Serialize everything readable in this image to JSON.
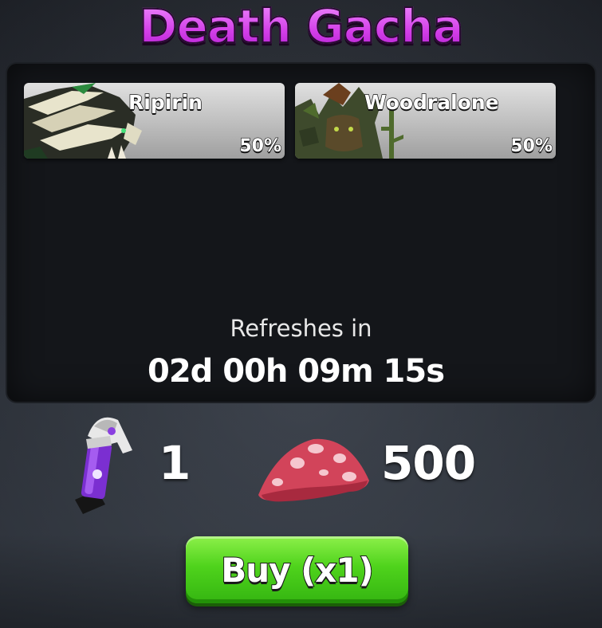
{
  "title": "Death Gacha",
  "pool": [
    {
      "name": "Ripirin",
      "chance": "50%",
      "icon": "skeletal-dragon-pet-icon"
    },
    {
      "name": "Woodralone",
      "chance": "50%",
      "icon": "tree-golem-pet-icon"
    }
  ],
  "refresh": {
    "label": "Refreshes in",
    "time": "02d 00h 09m 15s"
  },
  "cost": {
    "item_icon": "purple-skull-capsule-icon",
    "item_count": "1",
    "currency_icon": "red-mushroom-icon",
    "currency_amount": "500"
  },
  "buy_button": {
    "label": "Buy (x1)"
  },
  "colors": {
    "title": "#d23ee8",
    "panel": "#14161a",
    "card": "#bdbdbd",
    "buy_button": "#4fd31c",
    "mushroom": "#d2445a"
  }
}
